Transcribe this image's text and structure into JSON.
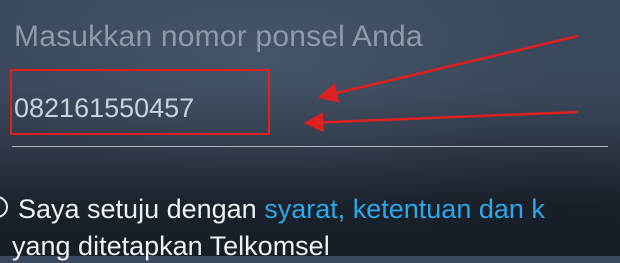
{
  "form": {
    "phone_label": "Masukkan nomor ponsel Anda",
    "phone_value": "082161550457"
  },
  "agreement": {
    "prefix": "Saya setuju dengan ",
    "link_text": "syarat, ketentuan dan k",
    "line2": "yang ditetapkan Telkomsel"
  },
  "colors": {
    "annotation": "#e02020",
    "link": "#2aa8ea",
    "label": "#8f9aaa"
  }
}
